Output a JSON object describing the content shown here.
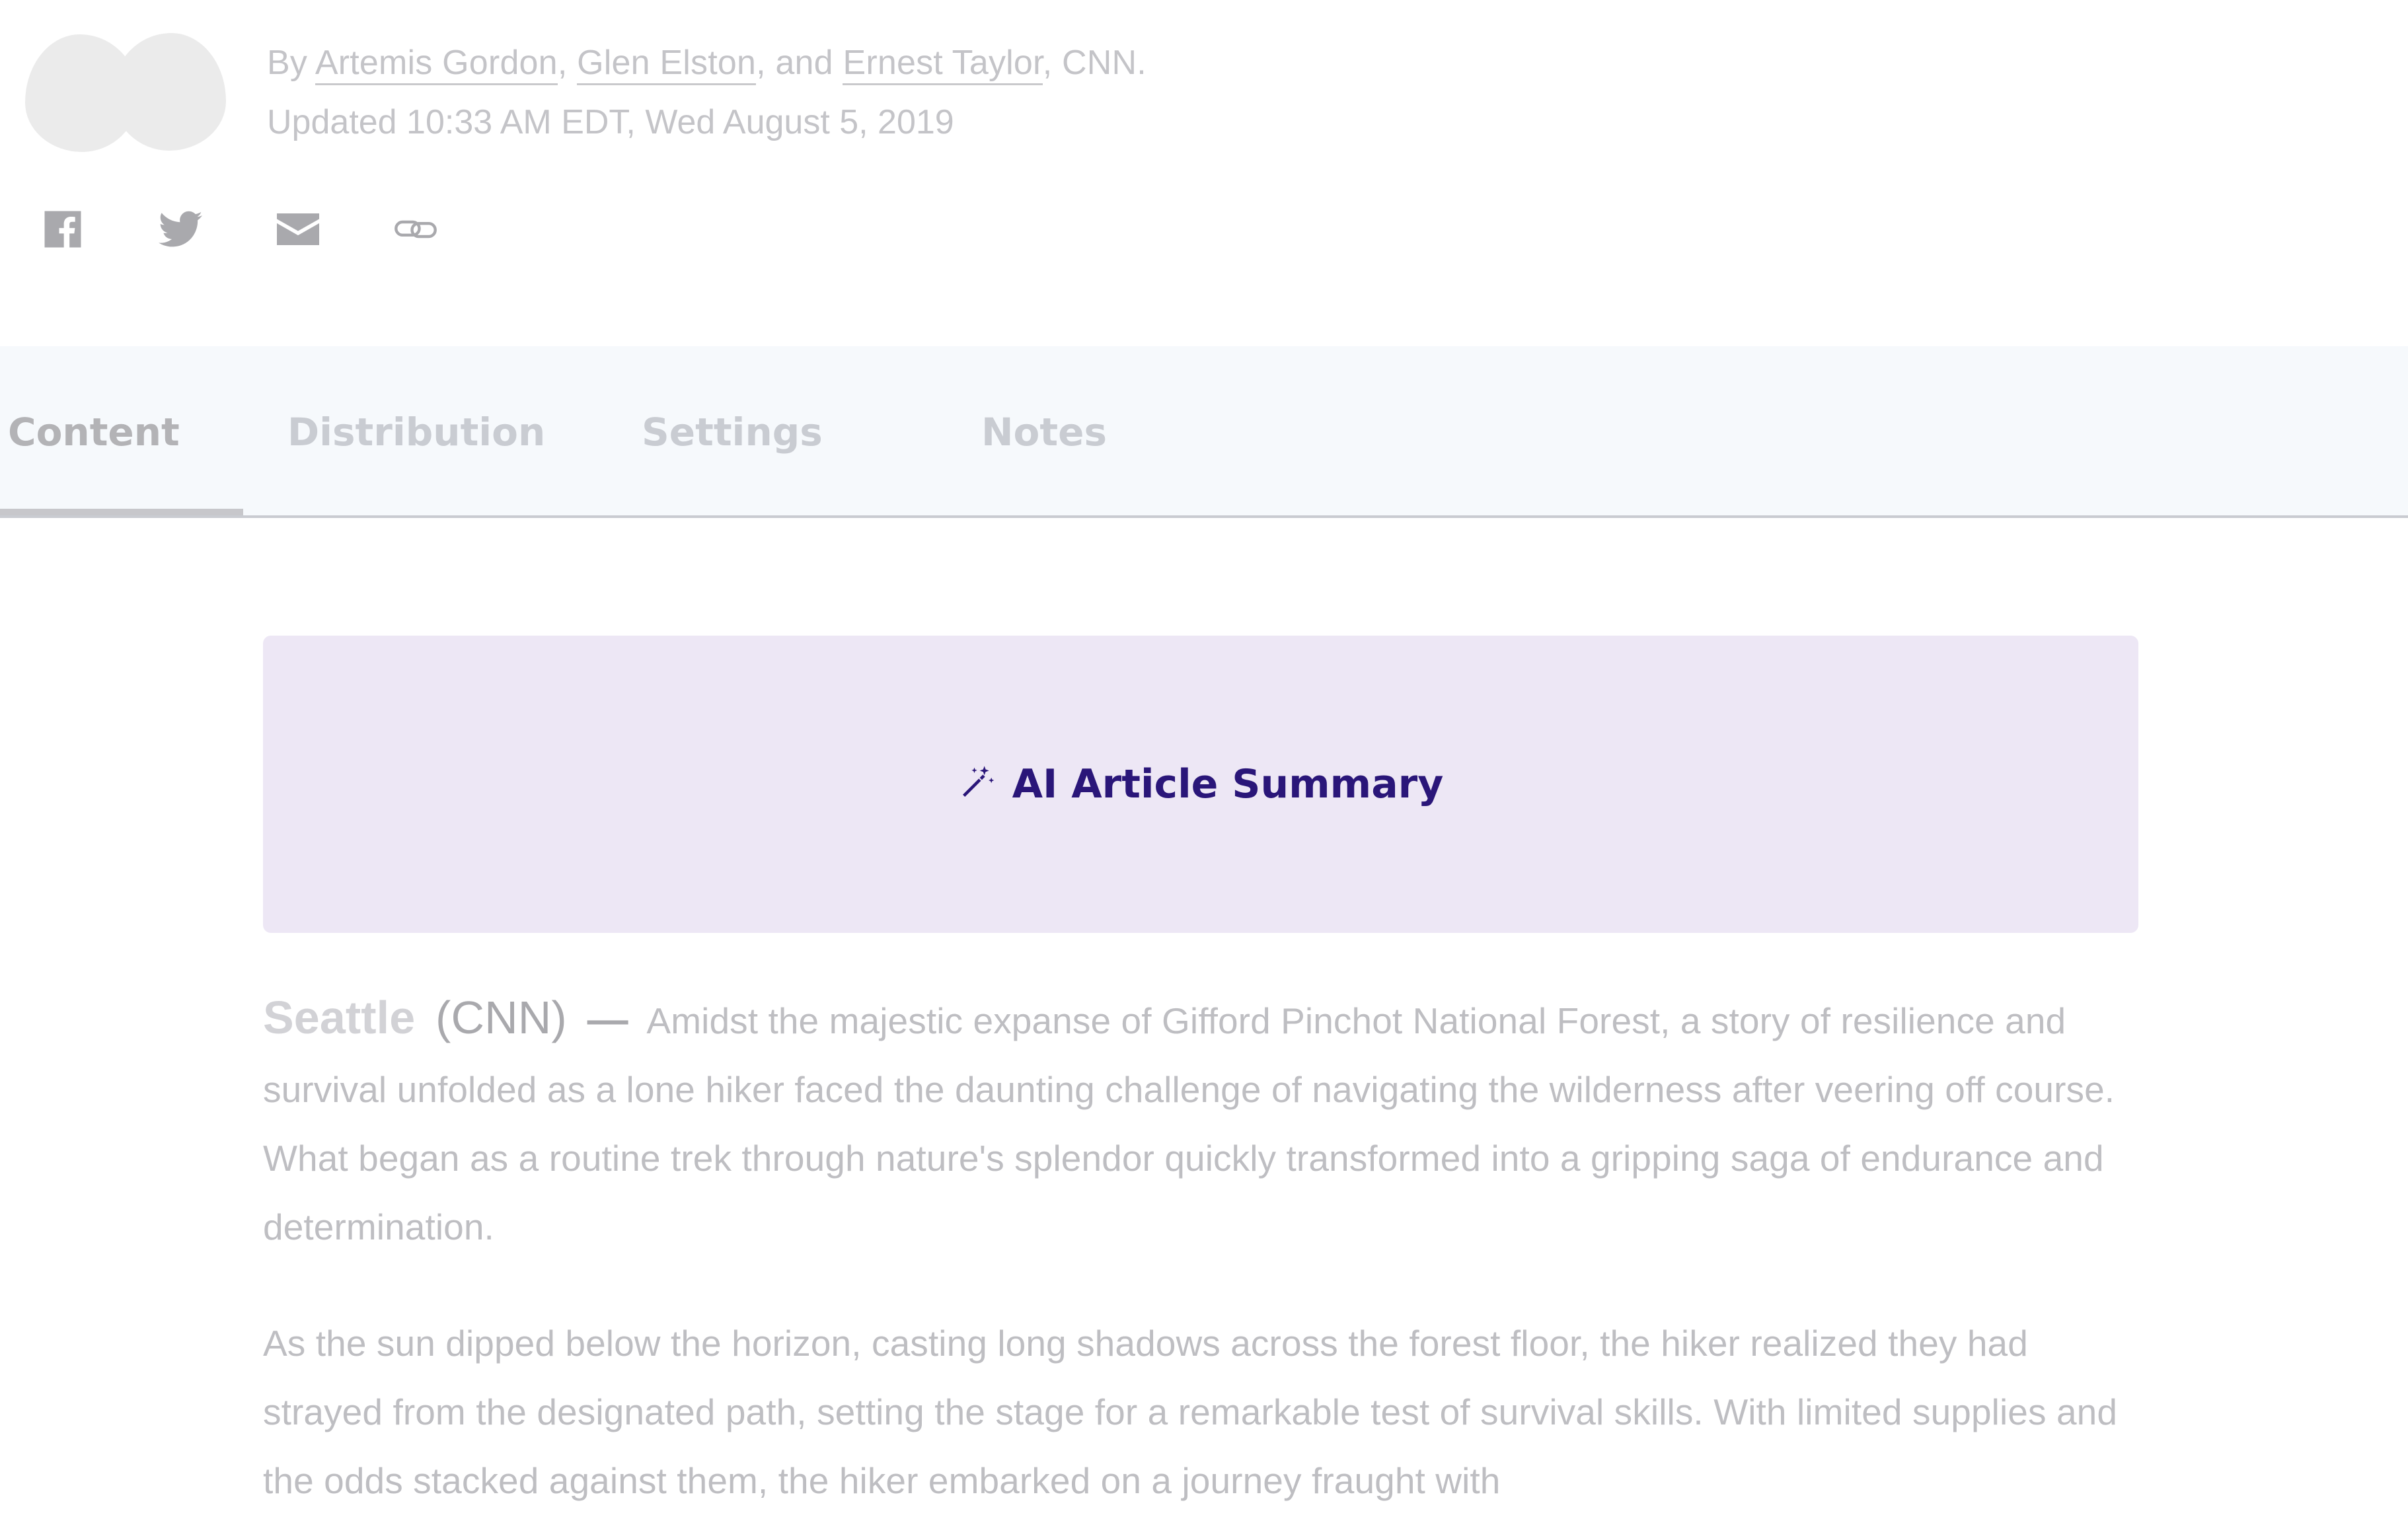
{
  "byline": {
    "prefix": "By",
    "authors": [
      "Artemis Gordon",
      "Glen Elston",
      "Ernest Taylor"
    ],
    "sep1": ",",
    "sep2": ", and",
    "suffix": ", CNN."
  },
  "updated": "Updated 10:33 AM EDT, Wed August 5, 2019",
  "share": {
    "icons": [
      "facebook-icon",
      "twitter-icon",
      "email-icon",
      "link-icon"
    ]
  },
  "tabs": [
    {
      "label": "Content",
      "active": true
    },
    {
      "label": "Distribution",
      "active": false
    },
    {
      "label": "Settings",
      "active": false
    },
    {
      "label": "Notes",
      "active": false
    }
  ],
  "ai_summary": {
    "label": "AI Article Summary",
    "icon": "magic-wand-icon"
  },
  "article": {
    "dateline_city": "Seattle",
    "dateline_source": "(CNN)",
    "dateline_dash": "—",
    "lead": "Amidst the majestic expanse of Gifford Pinchot National Forest, a story of resilience and survival unfolded as a lone hiker faced the daunting challenge of navigating the wilderness after veering off course. What began as a routine trek through nature's splendor quickly transformed into a gripping saga of endurance and determination.",
    "paragraph2": "As the sun dipped below the horizon, casting long shadows across the forest floor, the hiker realized they had strayed from the designated path, setting the stage for a remarkable test of survival skills. With limited supplies and the odds stacked against them, the hiker embarked on a journey fraught with"
  },
  "colors": {
    "ai_box_bg": "#ede7f5",
    "ai_text": "#2a1679",
    "tabbar_bg": "#f6f9fc",
    "muted_text": "#bebec2"
  }
}
